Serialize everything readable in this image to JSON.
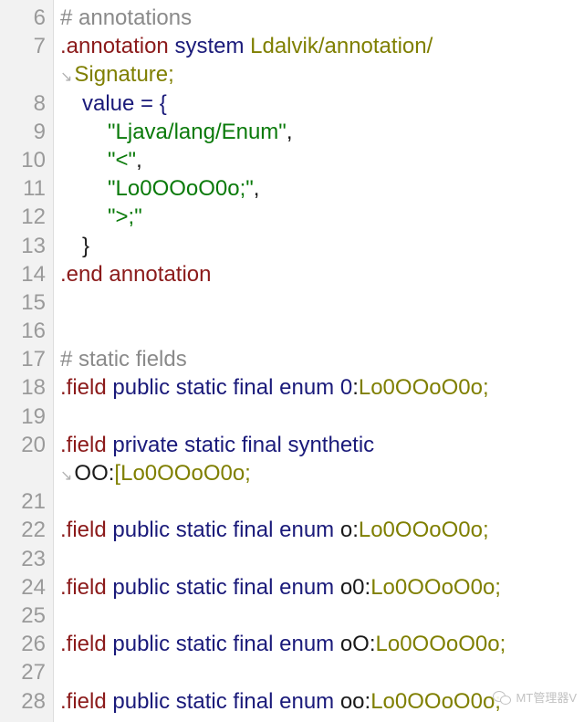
{
  "lines": [
    {
      "n": "6",
      "parts": [
        "# annotations"
      ]
    },
    {
      "n": "7",
      "parts": [
        ".annotation",
        " system ",
        "Ldalvik/annotation/"
      ]
    },
    {
      "n": "",
      "wrap": "↘",
      "parts": [
        "Signature;"
      ]
    },
    {
      "n": "8",
      "parts": [
        "value = {"
      ]
    },
    {
      "n": "9",
      "parts": [
        "\"Ljava/lang/Enum\"",
        ","
      ]
    },
    {
      "n": "10",
      "parts": [
        "\"<\"",
        ","
      ]
    },
    {
      "n": "11",
      "parts": [
        "\"Lo0OOoO0o;\"",
        ","
      ]
    },
    {
      "n": "12",
      "parts": [
        "\">;\""
      ]
    },
    {
      "n": "13",
      "parts": [
        "}"
      ]
    },
    {
      "n": "14",
      "parts": [
        ".end annotation"
      ]
    },
    {
      "n": "15",
      "parts": []
    },
    {
      "n": "16",
      "parts": []
    },
    {
      "n": "17",
      "parts": [
        "# static fields"
      ]
    },
    {
      "n": "18",
      "parts": [
        ".field",
        " public static final enum ",
        "0",
        ":",
        "Lo0OOoO0o;"
      ]
    },
    {
      "n": "19",
      "parts": []
    },
    {
      "n": "20",
      "parts": [
        ".field",
        " private static final synthetic"
      ]
    },
    {
      "n": "",
      "wrap": "↘",
      "parts": [
        "OO",
        ":",
        "[Lo0OOoO0o;"
      ]
    },
    {
      "n": "21",
      "parts": []
    },
    {
      "n": "22",
      "parts": [
        ".field",
        " public static final enum ",
        "o",
        ":",
        "Lo0OOoO0o;"
      ]
    },
    {
      "n": "23",
      "parts": []
    },
    {
      "n": "24",
      "parts": [
        ".field",
        " public static final enum ",
        "o0",
        ":",
        "Lo0OOoO0o;"
      ]
    },
    {
      "n": "25",
      "parts": []
    },
    {
      "n": "26",
      "parts": [
        ".field",
        " public static final enum ",
        "oO",
        ":",
        "Lo0OOoO0o;"
      ]
    },
    {
      "n": "27",
      "parts": []
    },
    {
      "n": "28",
      "parts": [
        ".field",
        " public static final enum ",
        "oo",
        ":",
        "Lo0OOoO0o;"
      ]
    }
  ],
  "watermark": {
    "icon": "wechat-icon",
    "text": "MT管理器V"
  },
  "colors": {
    "comment": "#8a8a8a",
    "directive": "#8b1a1a",
    "modifier": "#1a1a7a",
    "type": "#7f7f00",
    "string": "#0a7a0a",
    "gutter_bg": "#f2f2f2",
    "line_number": "#9a9a9a"
  }
}
